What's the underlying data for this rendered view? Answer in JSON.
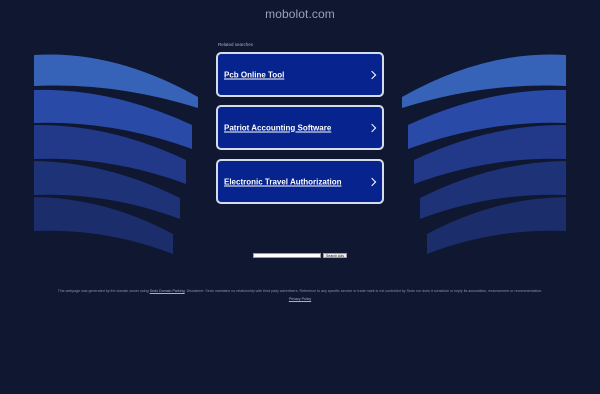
{
  "header": {
    "domain": "mobolot.com"
  },
  "related": {
    "label": "Related searches",
    "links": [
      {
        "label": "Pcb Online Tool"
      },
      {
        "label": "Patriot Accounting Software"
      },
      {
        "label": "Electronic Travel Authorization"
      }
    ]
  },
  "search": {
    "input_value": "",
    "button_label": "Search Ads"
  },
  "footer": {
    "disclaimer_prefix": "This webpage was generated by the domain owner using",
    "disclaimer_link": "Sedo Domain Parking",
    "disclaimer_suffix": ". Disclaimer: Sedo maintains no relationship with third party advertisers. Reference to any specific service or trade mark is not controlled by Sedo nor does it constitute or imply its association, endorsement or recommendation.",
    "privacy_label": "Privacy Policy"
  },
  "colors": {
    "background": "#0f1731",
    "card": "#07248e",
    "card_border": "#d7dcea",
    "wave_light": "#3560b5",
    "wave_mid": "#2946a3",
    "wave_dark": "#1f3579"
  },
  "icons": {
    "link_arrow": "chevron-right-icon"
  }
}
